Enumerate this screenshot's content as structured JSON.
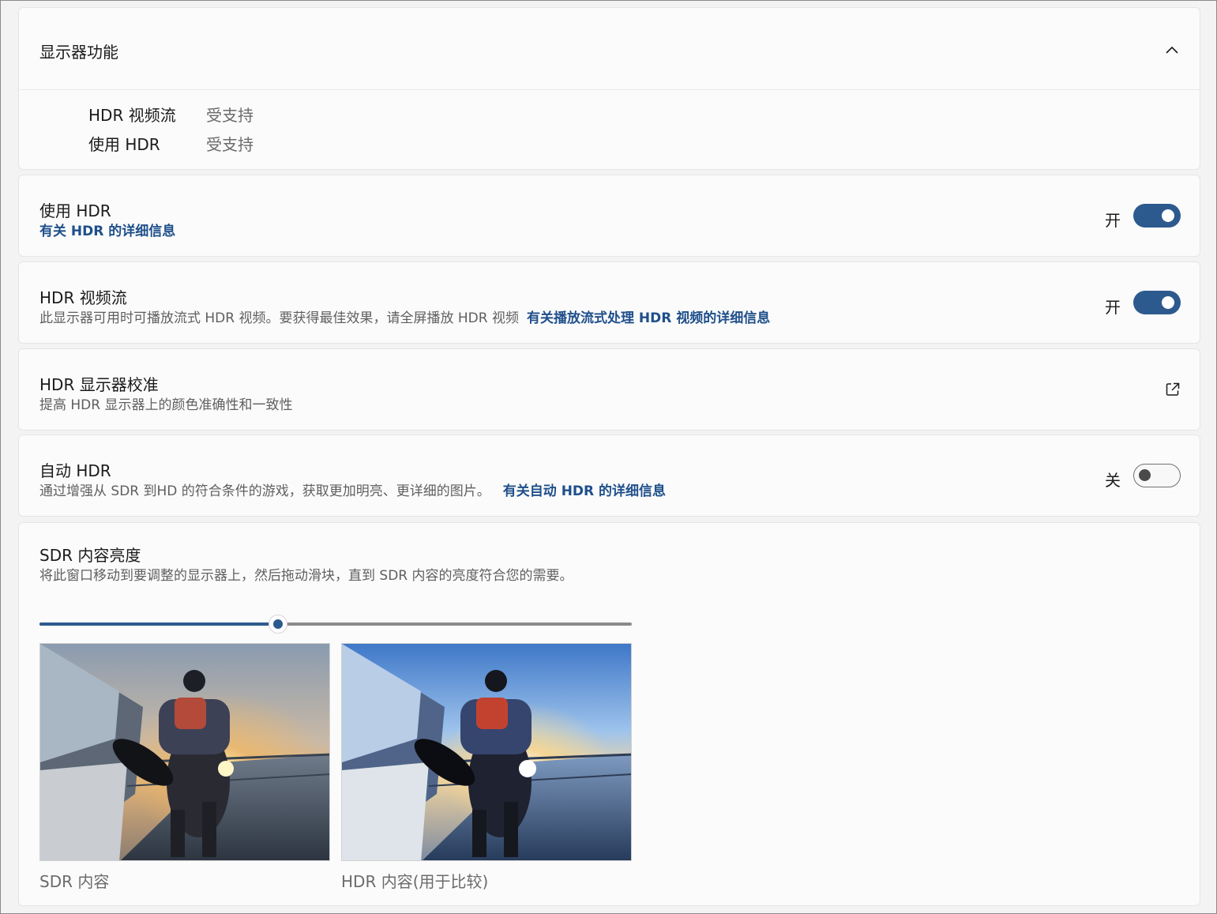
{
  "display_caps": {
    "title": "显示器功能",
    "rows": [
      {
        "label": "HDR 视频流",
        "value": "受支持"
      },
      {
        "label": "使用 HDR",
        "value": "受支持"
      }
    ]
  },
  "use_hdr": {
    "title": "使用 HDR",
    "link": "有关 HDR 的详细信息",
    "state": "开",
    "on": true
  },
  "hdr_streaming": {
    "title": "HDR 视频流",
    "desc": "此显示器可用时可播放流式 HDR 视频。要获得最佳效果，请全屏播放 HDR 视频",
    "link": "有关播放流式处理 HDR 视频的详细信息",
    "state": "开",
    "on": true
  },
  "calibration": {
    "title": "HDR 显示器校准",
    "desc": "提高 HDR 显示器上的颜色准确性和一致性"
  },
  "auto_hdr": {
    "title": "自动 HDR",
    "desc": "通过增强从 SDR 到HD 的符合条件的游戏，获取更加明亮、更详细的图片。",
    "link": "有关自动 HDR 的详细信息",
    "state": "关",
    "on": false
  },
  "sdr_brightness": {
    "title": "SDR 内容亮度",
    "desc": "将此窗口移动到要调整的显示器上，然后拖动滑块，直到 SDR 内容的亮度符合您的需要。",
    "slider_fraction": 0.403,
    "sdr_caption": "SDR 内容",
    "hdr_caption": "HDR 内容(用于比较)"
  },
  "colors": {
    "accent": "#2d5a8e",
    "link": "#1f4f8b"
  }
}
